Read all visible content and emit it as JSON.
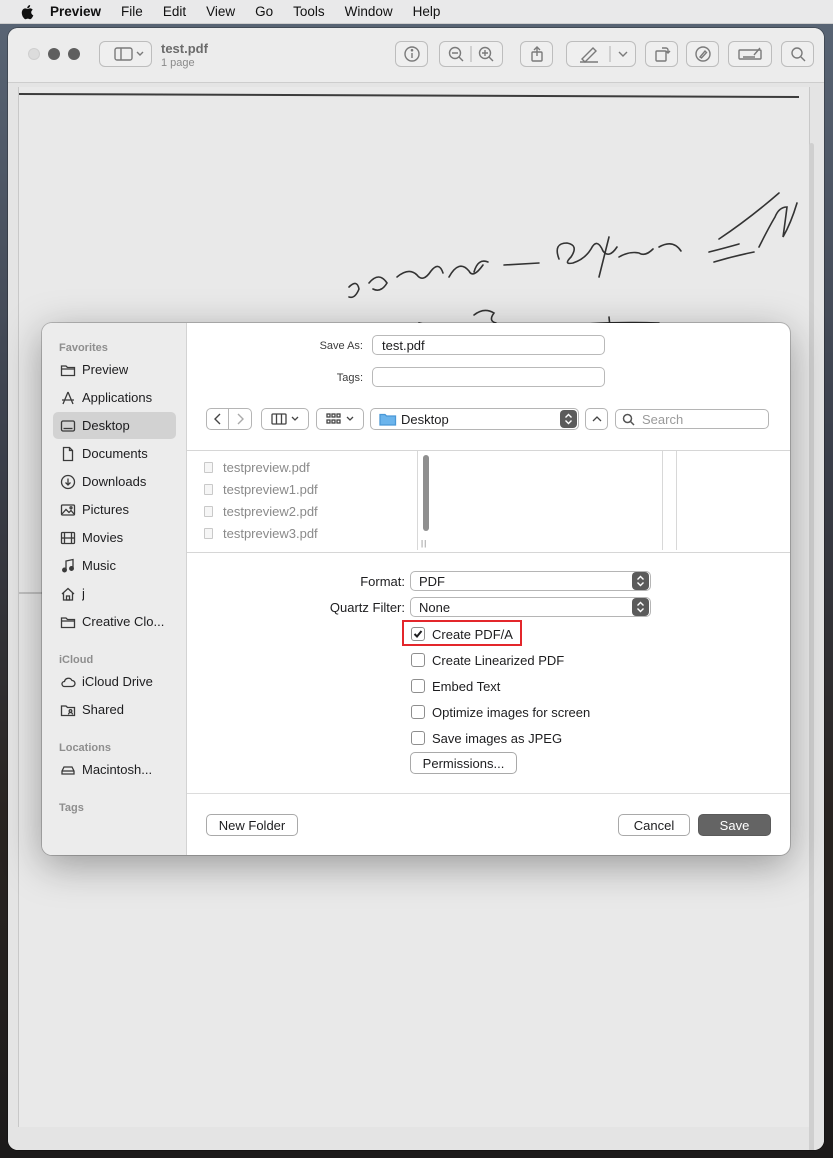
{
  "menubar": {
    "app_name": "Preview",
    "items": [
      "File",
      "Edit",
      "View",
      "Go",
      "Tools",
      "Window",
      "Help"
    ]
  },
  "window": {
    "doc_title": "test.pdf",
    "doc_subtitle": "1 page"
  },
  "dialog": {
    "save_as_label": "Save As:",
    "save_as_value": "test.pdf",
    "tags_label": "Tags:",
    "tags_value": "",
    "location": "Desktop",
    "search_placeholder": "Search",
    "sidebar": {
      "favorites_header": "Favorites",
      "favorites": [
        {
          "label": "Preview",
          "icon": "folder-icon"
        },
        {
          "label": "Applications",
          "icon": "applications-icon"
        },
        {
          "label": "Desktop",
          "icon": "desktop-icon",
          "selected": true
        },
        {
          "label": "Documents",
          "icon": "document-icon"
        },
        {
          "label": "Downloads",
          "icon": "downloads-icon"
        },
        {
          "label": "Pictures",
          "icon": "pictures-icon"
        },
        {
          "label": "Movies",
          "icon": "movies-icon"
        },
        {
          "label": "Music",
          "icon": "music-icon"
        },
        {
          "label": "j",
          "icon": "home-icon"
        },
        {
          "label": "Creative Clo...",
          "icon": "folder-icon"
        }
      ],
      "icloud_header": "iCloud",
      "icloud": [
        {
          "label": "iCloud Drive",
          "icon": "cloud-icon"
        },
        {
          "label": "Shared",
          "icon": "shared-folder-icon"
        }
      ],
      "locations_header": "Locations",
      "locations": [
        {
          "label": "Macintosh...",
          "icon": "disk-icon"
        }
      ],
      "tags_header": "Tags"
    },
    "files": [
      "testpreview.pdf",
      "testpreview1.pdf",
      "testpreview2.pdf",
      "testpreview3.pdf"
    ],
    "options": {
      "format_label": "Format:",
      "format_value": "PDF",
      "quartz_label": "Quartz Filter:",
      "quartz_value": "None",
      "checkboxes": [
        {
          "label": "Create PDF/A",
          "checked": true
        },
        {
          "label": "Create Linearized PDF",
          "checked": false
        },
        {
          "label": "Embed Text",
          "checked": false
        },
        {
          "label": "Optimize images for screen",
          "checked": false
        },
        {
          "label": "Save images as JPEG",
          "checked": false
        }
      ],
      "permissions_label": "Permissions..."
    },
    "new_folder_label": "New Folder",
    "cancel_label": "Cancel",
    "save_label": "Save"
  },
  "colors": {
    "highlight_box": "#e3262b",
    "primary_button": "#646464",
    "sidebar_selection": "#d2d2d2"
  }
}
